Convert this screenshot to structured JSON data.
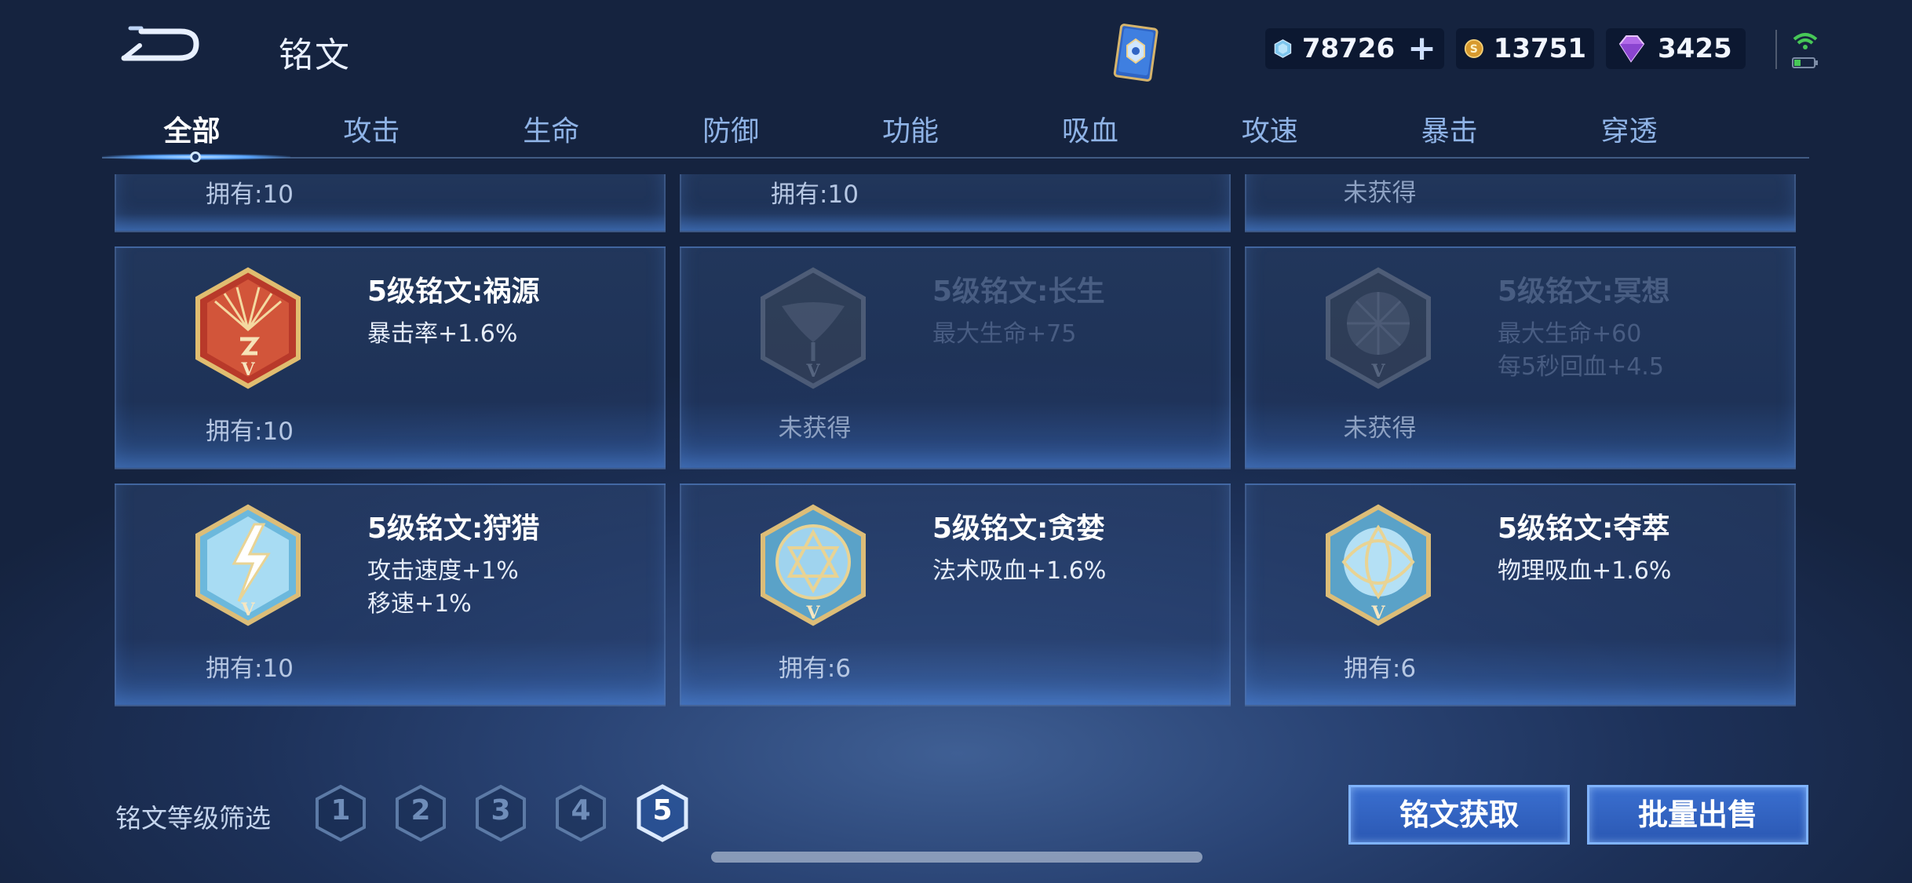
{
  "header": {
    "title": "铭文",
    "currencies": [
      {
        "name": "diamond",
        "amount": "78726"
      },
      {
        "name": "gold",
        "amount": "13751"
      },
      {
        "name": "gem",
        "amount": "3425"
      }
    ]
  },
  "tabs": [
    "全部",
    "攻击",
    "生命",
    "防御",
    "功能",
    "吸血",
    "攻速",
    "暴击",
    "穿透"
  ],
  "active_tab": "全部",
  "partial_row": [
    {
      "owned": "拥有:10"
    },
    {
      "owned": "拥有:10"
    },
    {
      "owned": "未获得"
    }
  ],
  "runes": [
    {
      "name": "5级铭文:祸源",
      "attrs": [
        "暴击率+1.6%"
      ],
      "owned": "拥有:10",
      "color": "#c2402a",
      "acquired": true
    },
    {
      "name": "5级铭文:长生",
      "attrs": [
        "最大生命+75"
      ],
      "owned": "未获得",
      "color": "#5a7a8a",
      "acquired": false
    },
    {
      "name": "5级铭文:冥想",
      "attrs": [
        "最大生命+60",
        "每5秒回血+4.5"
      ],
      "owned": "未获得",
      "color": "#5a7a8a",
      "acquired": false
    },
    {
      "name": "5级铭文:狩猎",
      "attrs": [
        "攻击速度+1%",
        "移速+1%"
      ],
      "owned": "拥有:10",
      "color": "#7cc6e8",
      "acquired": true
    },
    {
      "name": "5级铭文:贪婪",
      "attrs": [
        "法术吸血+1.6%"
      ],
      "owned": "拥有:6",
      "color": "#8ec8ea",
      "acquired": true
    },
    {
      "name": "5级铭文:夺萃",
      "attrs": [
        "物理吸血+1.6%"
      ],
      "owned": "拥有:6",
      "color": "#8ec8ea",
      "acquired": true
    }
  ],
  "filter": {
    "label": "铭文等级筛选",
    "levels": [
      "1",
      "2",
      "3",
      "4",
      "5"
    ],
    "selected": "5"
  },
  "buttons": {
    "acquire": "铭文获取",
    "bulk_sell": "批量出售"
  },
  "colors": {
    "accent": "#3a6fd0",
    "gold_frame": "#d8b66a"
  }
}
